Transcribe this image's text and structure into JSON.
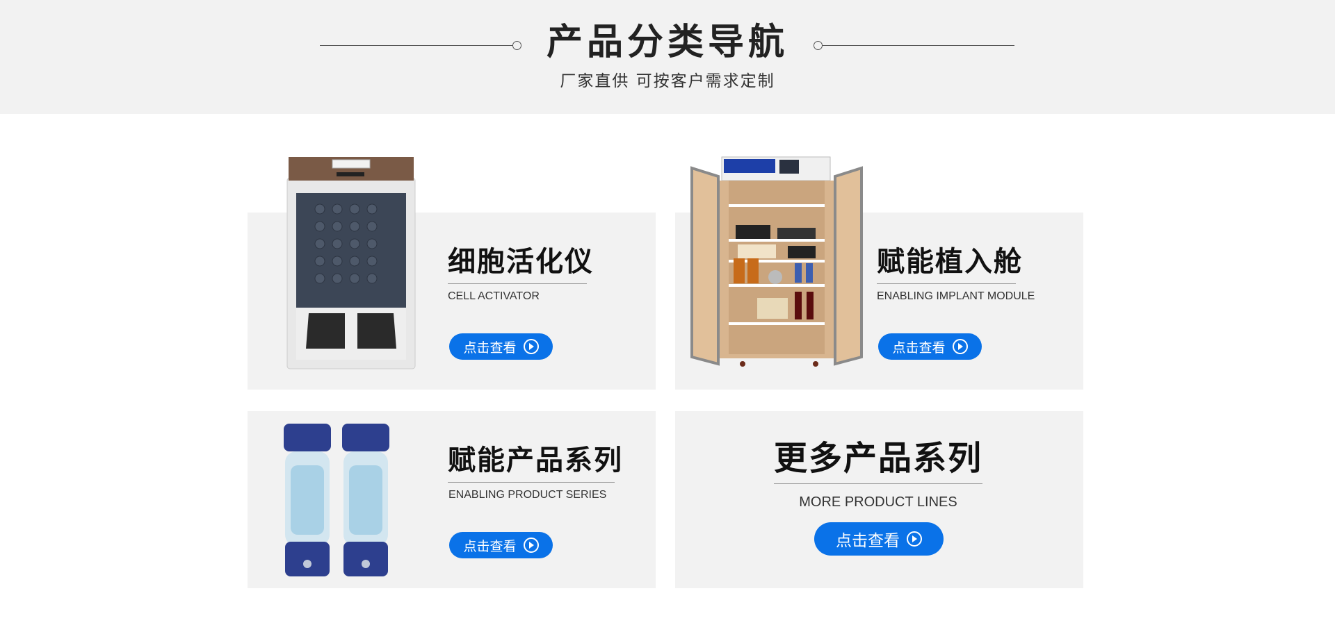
{
  "header": {
    "title": "产品分类导航",
    "subtitle": "厂家直供  可按客户需求定制"
  },
  "products": [
    {
      "name": "细胞活化仪",
      "english": "CELL ACTIVATOR",
      "button": "点击查看"
    },
    {
      "name": "赋能植入舱",
      "english": "ENABLING IMPLANT MODULE",
      "button": "点击查看"
    },
    {
      "name": "赋能产品系列",
      "english": "ENABLING PRODUCT SERIES",
      "button": "点击查看"
    },
    {
      "name": "更多产品系列",
      "english": "MORE PRODUCT LINES",
      "button": "点击查看"
    }
  ],
  "colors": {
    "accent": "#0a72e8",
    "panel": "#f2f2f2"
  }
}
